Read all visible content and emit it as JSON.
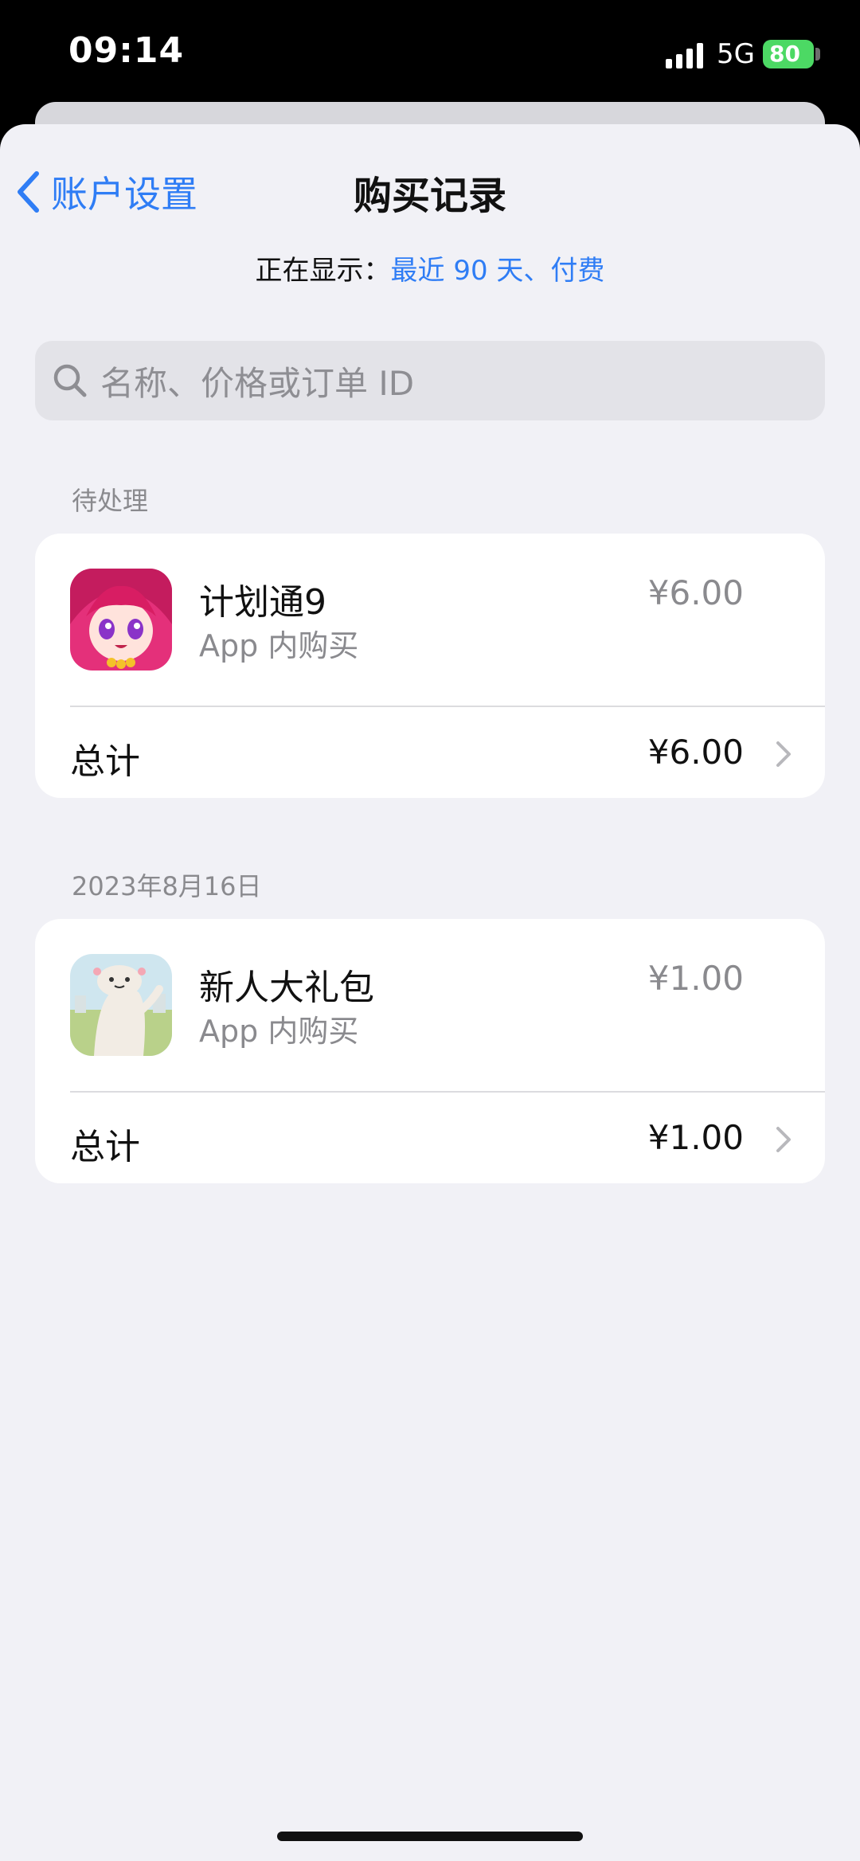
{
  "status": {
    "time": "09:14",
    "network": "5G",
    "battery": "80"
  },
  "nav": {
    "back_label": "账户设置",
    "title": "购买记录"
  },
  "filter": {
    "prefix": "正在显示：",
    "value": "最近 90 天、付费"
  },
  "search": {
    "placeholder": "名称、价格或订单 ID"
  },
  "sections": [
    {
      "header": "待处理",
      "item": {
        "name": "计划通9",
        "type": "App 内购买",
        "price": "¥6.00",
        "icon": "anime-girl-app-icon"
      },
      "total_label": "总计",
      "total_value": "¥6.00"
    },
    {
      "header": "2023年8月16日",
      "item": {
        "name": "新人大礼包",
        "type": "App 内购买",
        "price": "¥1.00",
        "icon": "axolotl-app-icon"
      },
      "total_label": "总计",
      "total_value": "¥1.00"
    }
  ],
  "colors": {
    "accent": "#2f7df5",
    "background": "#f1f1f6",
    "battery": "#4cd964"
  }
}
